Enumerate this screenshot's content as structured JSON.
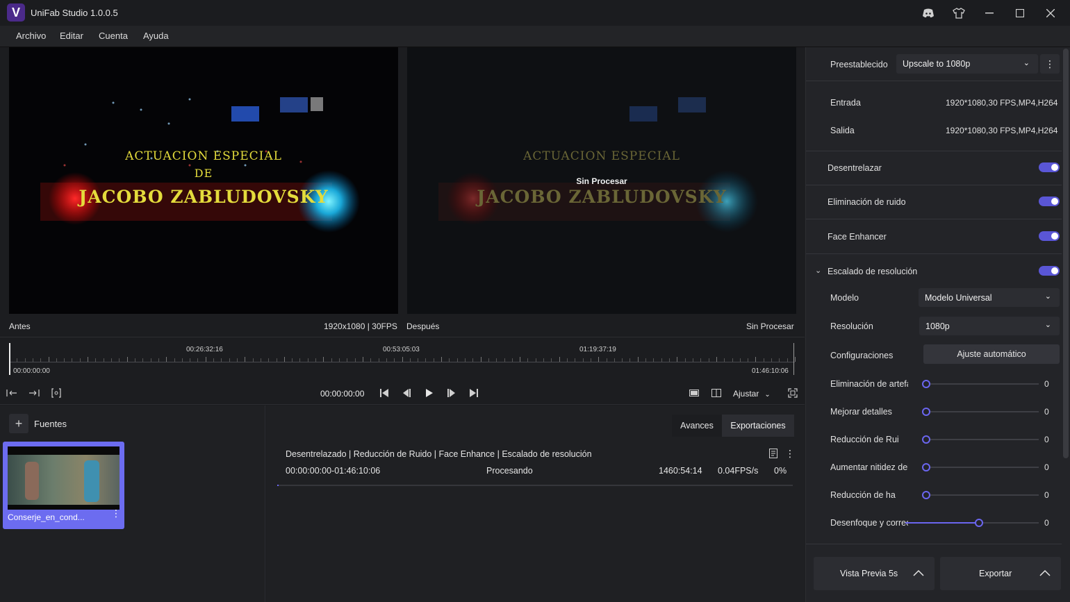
{
  "app": {
    "title": "UniFab Studio 1.0.0.5",
    "logo_letter": "V"
  },
  "menu": [
    "Archivo",
    "Editar",
    "Cuenta",
    "Ayuda"
  ],
  "preview": {
    "before_label": "Antes",
    "resolution_info": "1920x1080 | 30FPS",
    "after_label": "Después",
    "after_status": "Sin Procesar",
    "overlay_text": "Sin Procesar",
    "caption_line1": "ACTUACION ESPECIAL",
    "caption_line2": "DE",
    "caption_line3": "JACOBO ZABLUDOVSKY"
  },
  "timeline": {
    "start": "00:00:00:00",
    "end": "01:46:10:06",
    "marks": [
      "00:26:32:16",
      "00:53:05:03",
      "01:19:37:19"
    ]
  },
  "controls": {
    "current_time": "00:00:00:00",
    "fit_label": "Ajustar"
  },
  "sources": {
    "title": "Fuentes",
    "items": [
      {
        "name": "Conserje_en_cond..."
      }
    ]
  },
  "exports": {
    "tabs": [
      "Avances",
      "Exportaciones"
    ],
    "active_tab": "Exportaciones",
    "job": {
      "pipeline": "Desentrelazado | Reducción de Ruido | Face Enhance | Escalado de resolución",
      "range": "00:00:00:00-01:46:10:06",
      "status": "Procesando",
      "eta": "1460:54:14",
      "speed": "0.04FPS/s",
      "progress": "0%"
    }
  },
  "panel": {
    "preset_label": "Preestablecido",
    "preset_value": "Upscale to 1080p",
    "input_label": "Entrada",
    "input_value": "1920*1080,30 FPS,MP4,H264",
    "output_label": "Salida",
    "output_value": "1920*1080,30 FPS,MP4,H264",
    "toggles": [
      {
        "label": "Desentrelazar",
        "on": true
      },
      {
        "label": "Eliminación de ruido",
        "on": true
      },
      {
        "label": "Face Enhancer",
        "on": true
      },
      {
        "label": "Escalado de resolución",
        "on": true
      }
    ],
    "model_label": "Modelo",
    "model_value": "Modelo Universal",
    "resolution_label": "Resolución",
    "resolution_value": "1080p",
    "config_label": "Configuraciones",
    "config_button": "Ajuste automático",
    "sliders": [
      {
        "label": "Eliminación de artefa",
        "value": "0",
        "level": 0
      },
      {
        "label": "Mejorar detalles",
        "value": "0",
        "level": 0
      },
      {
        "label": "Reducción de Rui",
        "value": "0",
        "level": 0
      },
      {
        "label": "Aumentar nitidez del",
        "value": "0",
        "level": 0
      },
      {
        "label": "Reducción de ha",
        "value": "0",
        "level": 0
      },
      {
        "label": "Desenfoque y correcció",
        "value": "0",
        "level": 0.55
      }
    ],
    "preview_button": "Vista Previa 5s",
    "export_button": "Exportar"
  },
  "colors": {
    "accent": "#5a56d6",
    "source_selected": "#6c6cf0"
  }
}
